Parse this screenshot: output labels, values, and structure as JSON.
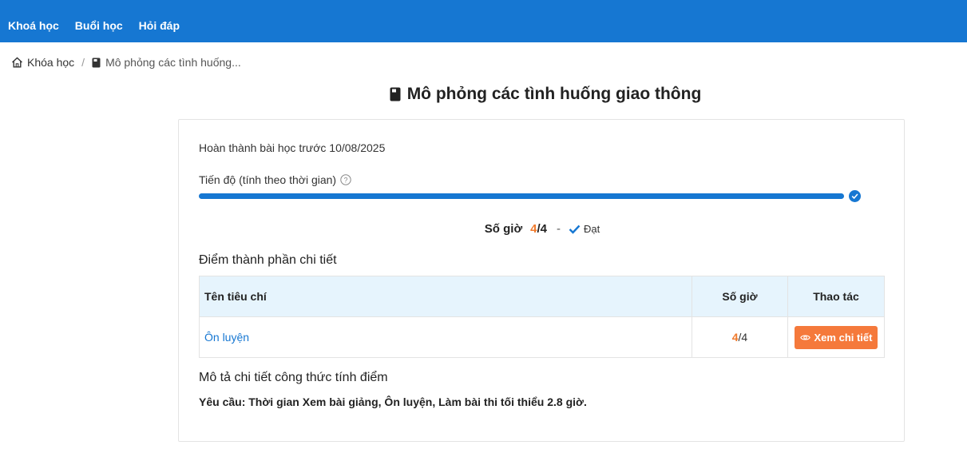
{
  "nav": {
    "items": [
      {
        "label": "Khoá học"
      },
      {
        "label": "Buổi học"
      },
      {
        "label": "Hỏi đáp"
      }
    ]
  },
  "breadcrumb": {
    "home_label": "Khóa học",
    "separator": "/",
    "current_label": "Mô phỏng các tình huống..."
  },
  "page": {
    "title": "Mô phỏng các tình huống giao thông"
  },
  "summary": {
    "deadline_text": "Hoàn thành bài học trước 10/08/2025",
    "progress_label": "Tiến độ (tính theo thời gian)",
    "progress_fraction": 1.0,
    "hours_label": "Số giờ",
    "hours_done": "4",
    "hours_total": "/4",
    "dash": "-",
    "status_text": "Đạt"
  },
  "components": {
    "section_title": "Điểm thành phần chi tiết",
    "columns": [
      "Tên tiêu chí",
      "Số giờ",
      "Thao tác"
    ],
    "rows": [
      {
        "name": "Ôn luyện",
        "done": "4",
        "total": "/4",
        "action_label": "Xem chi tiết"
      }
    ]
  },
  "formula": {
    "section_title": "Mô tả chi tiết công thức tính điểm",
    "requirement": "Yêu cầu: Thời gian Xem bài giảng, Ôn luyện, Làm bài thi tối thiểu 2.8 giờ."
  },
  "colors": {
    "primary": "#1677d2",
    "accent_orange": "#f07a2c",
    "table_header_bg": "#e6f4fd"
  }
}
